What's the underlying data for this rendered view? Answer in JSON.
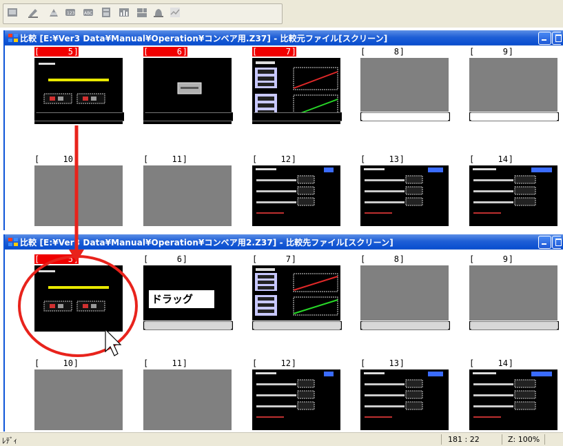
{
  "toolbar": {
    "icons": [
      "screen-icon",
      "edit-icon",
      "parts-icon",
      "number-icon",
      "text-icon",
      "calc-icon",
      "graph-icon",
      "display-icon",
      "alarm-icon",
      "trend-icon"
    ]
  },
  "panel_top": {
    "title": "比較 [E:¥Ver3 Data¥Manual¥Operation¥コンベア用.Z37] - 比較元ファイル[スクリーン]",
    "cells_row1": [
      {
        "num": "5",
        "selected": true
      },
      {
        "num": "6",
        "selected": true
      },
      {
        "num": "7",
        "selected": true
      },
      {
        "num": "8",
        "selected": false
      },
      {
        "num": "9",
        "selected": false
      }
    ],
    "cells_row2": [
      {
        "num": "10"
      },
      {
        "num": "11"
      },
      {
        "num": "12"
      },
      {
        "num": "13"
      },
      {
        "num": "14"
      }
    ]
  },
  "panel_bottom": {
    "title": "比較 [E:¥Ver3 Data¥Manual¥Operation¥コンベア用2.Z37] - 比較先ファイル[スクリーン]",
    "cells_row1": [
      {
        "num": "5",
        "selected": true
      },
      {
        "num": "6",
        "selected": false
      },
      {
        "num": "7",
        "selected": false
      },
      {
        "num": "8",
        "selected": false
      },
      {
        "num": "9",
        "selected": false
      }
    ],
    "cells_row2": [
      {
        "num": "10"
      },
      {
        "num": "11"
      },
      {
        "num": "12"
      },
      {
        "num": "13"
      },
      {
        "num": "14"
      }
    ]
  },
  "drag_label": "ドラッグ",
  "status": {
    "text": "ﾚﾃﾞｨ",
    "coords": "181 : 22",
    "zoom": "Z: 100%"
  },
  "colors": {
    "title_blue": "#0a4fd0",
    "selected_red": "#f00000",
    "annotation_red": "#e8231c",
    "thumb_gray": "#808080"
  }
}
